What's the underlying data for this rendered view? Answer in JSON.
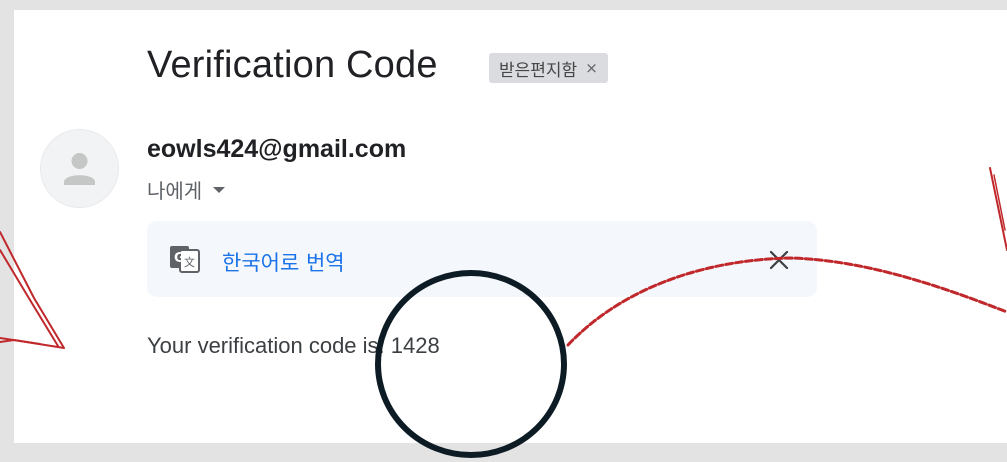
{
  "email": {
    "subject": "Verification Code",
    "label_chip": {
      "text": "받은편지함",
      "remove": "×"
    },
    "sender": "eowls424@gmail.com",
    "recipient": "나에게",
    "translate_bar": {
      "link": "한국어로 번역"
    },
    "body": "Your verification code is: 1428"
  },
  "icons": {
    "avatar": "person-icon",
    "recipient_details": "caret-down-icon",
    "translate": "google-translate-icon",
    "close": "close-icon"
  },
  "colors": {
    "link": "#1a73e8",
    "annotation_red": "#c0282b",
    "annotation_circle": "#0d1b24"
  }
}
